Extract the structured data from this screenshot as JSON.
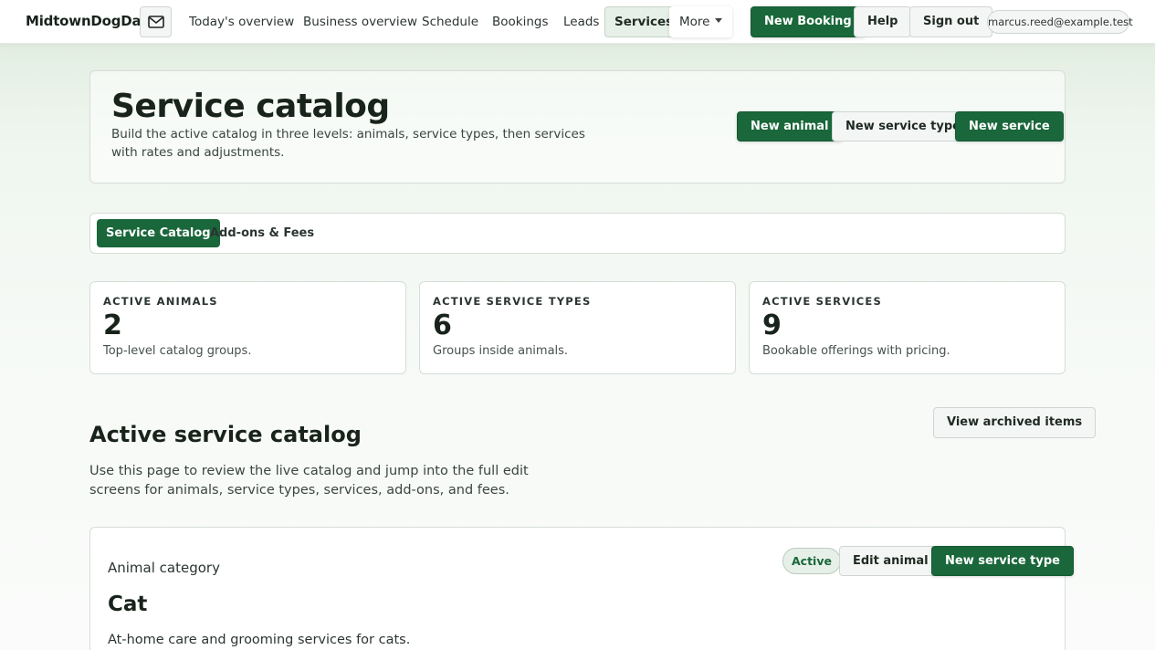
{
  "nav": {
    "brand": "MidtownDogDad",
    "links": [
      "Today's overview",
      "Business overview",
      "Schedule",
      "Bookings",
      "Leads",
      "Services"
    ],
    "more_label": "More",
    "new_booking": "New Booking",
    "help": "Help",
    "sign_out": "Sign out",
    "user_email": "marcus.reed@example.test",
    "active_link": "Services"
  },
  "hero": {
    "title": "Service catalog",
    "description": "Build the active catalog in three levels: animals, service types, then services with rates and adjustments.",
    "buttons": [
      "New animal",
      "New service type",
      "New service"
    ]
  },
  "tabs": [
    "Service Catalog",
    "Add-ons & Fees"
  ],
  "stats": [
    {
      "label": "ACTIVE ANIMALS",
      "value": "2",
      "desc": "Top-level catalog groups."
    },
    {
      "label": "ACTIVE SERVICE TYPES",
      "value": "6",
      "desc": "Groups inside animals."
    },
    {
      "label": "ACTIVE SERVICES",
      "value": "9",
      "desc": "Bookable offerings with pricing."
    }
  ],
  "section": {
    "title": "Active service catalog",
    "description": "Use this page to review the live catalog and jump into the full edit screens for animals, service types, services, add-ons, and fees.",
    "archived_button": "View archived items"
  },
  "animal": {
    "category_label": "Animal category",
    "name": "Cat",
    "description": "At-home care and grooming services for cats.",
    "status": "Active",
    "edit_button": "Edit animal",
    "new_type_button": "New service type"
  },
  "colors": {
    "accent": "#19673a",
    "background_tint": "#e4efe3"
  },
  "icons": {
    "mail": "mail-icon"
  }
}
